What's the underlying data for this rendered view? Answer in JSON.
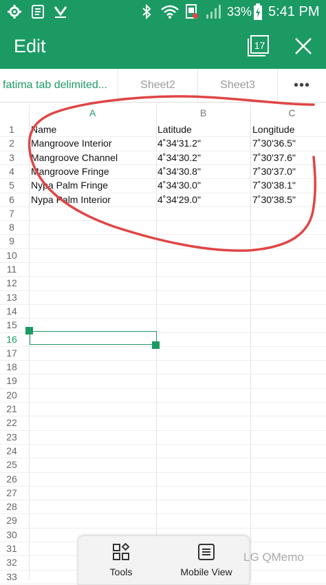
{
  "status_bar": {
    "battery": "33%",
    "time": "5:41 PM",
    "icons": [
      "gear-icon",
      "notes-icon",
      "download-check-icon",
      "bluetooth-icon",
      "wifi-icon",
      "sim-icon",
      "signal-icon",
      "battery-charging-icon"
    ]
  },
  "app_bar": {
    "title": "Edit",
    "calendar_day": "17",
    "icons": [
      "calendar-icon",
      "close-icon"
    ]
  },
  "sheet_tabs": {
    "items": [
      {
        "label": "fatima tab delimited..."
      },
      {
        "label": "Sheet2"
      },
      {
        "label": "Sheet3"
      },
      {
        "label": "•••"
      }
    ]
  },
  "grid": {
    "column_headers": [
      "A",
      "B",
      "C"
    ],
    "row_numbers": [
      "1",
      "2",
      "3",
      "4",
      "5",
      "6",
      "7",
      "8",
      "9",
      "10",
      "11",
      "12",
      "13",
      "14",
      "15",
      "16",
      "17",
      "18",
      "19",
      "20",
      "21",
      "22",
      "23",
      "24",
      "25",
      "26",
      "27",
      "28",
      "29",
      "30",
      "31",
      "32",
      "33"
    ],
    "rows": [
      [
        "Name",
        "Latitude",
        "Longitude"
      ],
      [
        "Mangroove Interior",
        "4˚34'31.2\"",
        "7˚30'36.5\""
      ],
      [
        "Mangroove Channel",
        "4˚34'30.2\"",
        "7˚30'37.6\""
      ],
      [
        "Mangroove Fringe",
        "4˚34'30.8\"",
        "7˚30'37.0\""
      ],
      [
        "Nypa Palm Fringe",
        "4˚34'30.0\"",
        "7˚30'38.1\""
      ],
      [
        "Nypa Palm Interior",
        "4˚34'29.0\"",
        "7˚30'38.5\""
      ]
    ],
    "selected_cell": "A16"
  },
  "toolbar": {
    "tools_label": "Tools",
    "mobile_view_label": "Mobile View"
  },
  "watermark": "LG QMemo",
  "colors": {
    "accent": "#1c9a64",
    "annotation": "#e04545"
  }
}
